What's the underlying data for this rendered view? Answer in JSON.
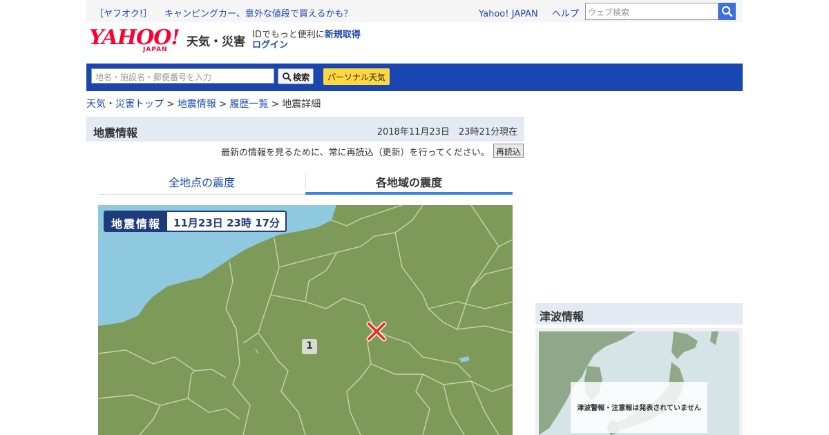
{
  "util_bar": {
    "promo_bracket": "［ヤフオク!］",
    "promo_text": "キャンピングカー、意外な値段で買えるかも？",
    "links": [
      "Yahoo! JAPAN",
      "ヘルプ"
    ],
    "search_placeholder": "ウェブ検索",
    "search_icon": "search-icon"
  },
  "header": {
    "logo_main": "YAHOO!",
    "logo_sub": "JAPAN",
    "service_name": "天気・災害",
    "id_text": "IDでもっと便利に",
    "signup": "新規取得",
    "login": "ログイン"
  },
  "search_bar": {
    "placeholder": "地名・施設名・郵便番号を入力",
    "button_label": "検索",
    "personal_label": "パーソナル天気"
  },
  "breadcrumb": {
    "items": [
      "天気・災害トップ",
      "地震情報",
      "履歴一覧"
    ],
    "current": "地震詳細",
    "separator": ">"
  },
  "main": {
    "section_title": "地震情報",
    "date": "2018年11月23日　23時21分現在",
    "reload_note": "最新の情報を見るために、常に再読込（更新）を行ってください。",
    "reload_button": "再読込",
    "tabs": [
      {
        "label": "全地点の震度",
        "active": false
      },
      {
        "label": "各地域の震度",
        "active": true
      }
    ]
  },
  "map": {
    "badge_label": "地震情報",
    "badge_time": "11月23日 23時 17分",
    "intensity_label": "1",
    "epicenter_icon": "epicenter-x-icon",
    "colors": {
      "land": "#7e9a58",
      "sea": "#8fc9df",
      "border": "#c8d4b4",
      "epicenter": "#e8331e"
    }
  },
  "tsunami": {
    "title": "津波情報",
    "message": "津波警報・注意報は発表されていません"
  }
}
